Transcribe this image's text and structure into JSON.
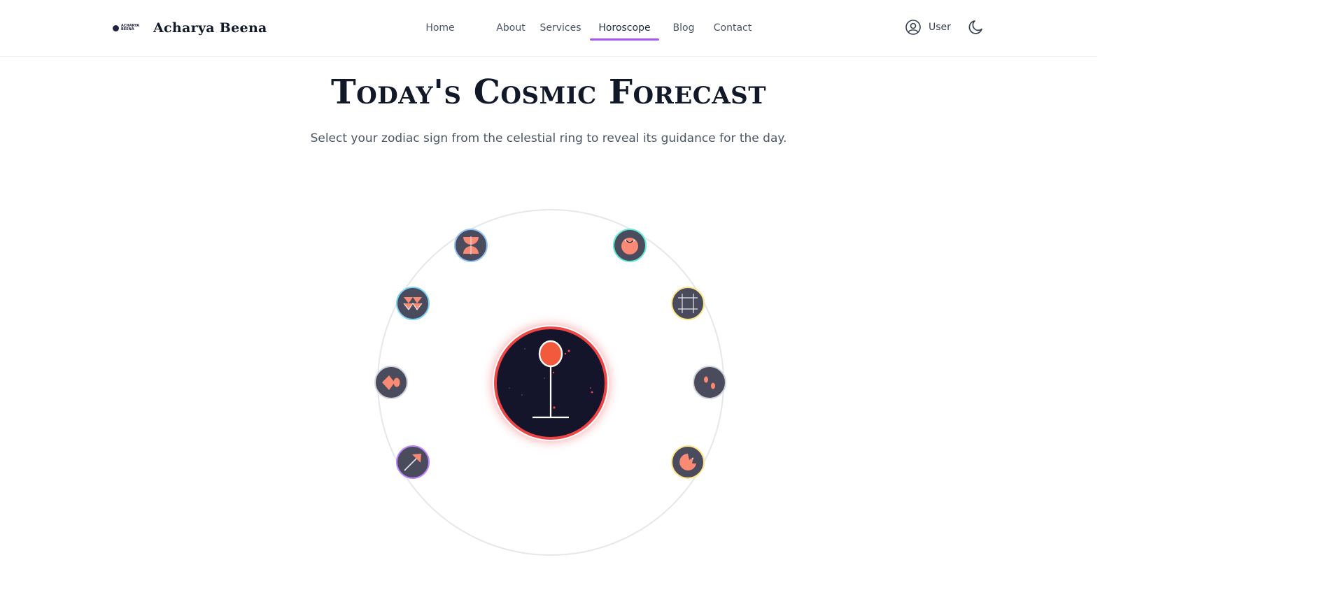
{
  "brand": {
    "logo_text_line1": "ACHARYA",
    "logo_text_line2": "BEENA",
    "name": "Acharya Beena"
  },
  "nav": {
    "items": [
      {
        "label": "Home"
      },
      {
        "label": "About"
      },
      {
        "label": "Services"
      },
      {
        "label": "Horoscope",
        "active": true
      },
      {
        "label": "Blog"
      },
      {
        "label": "Contact"
      }
    ],
    "active_color": "#a855f7"
  },
  "user": {
    "label": "User",
    "icon": "user-circle-icon"
  },
  "theme_toggle": {
    "icon": "moon-icon"
  },
  "hero": {
    "title": "Today's Cosmic Forecast",
    "subtitle": "Select your zodiac sign from the celestial ring to reveal its guidance for the day."
  },
  "zodiac_ring": {
    "selected": "aries",
    "selected_ring_color": "#ef4444",
    "signs": [
      {
        "name": "aries",
        "icon": "aries-icon",
        "border_color": "#ef4444"
      },
      {
        "name": "taurus",
        "icon": "taurus-icon",
        "border_color": "#5eead4"
      },
      {
        "name": "gemini",
        "icon": "gemini-icon",
        "border_color": "#fde68a"
      },
      {
        "name": "cancer",
        "icon": "cancer-icon",
        "border_color": "#d1d5db"
      },
      {
        "name": "leo",
        "icon": "leo-icon",
        "border_color": "#fde68a"
      },
      {
        "name": "sagittarius",
        "icon": "sagittarius-icon",
        "border_color": "#c084fc"
      },
      {
        "name": "capricorn",
        "icon": "capricorn-icon",
        "border_color": "#d1d5db"
      },
      {
        "name": "aquarius",
        "icon": "aquarius-icon",
        "border_color": "#7dd3fc"
      },
      {
        "name": "pisces",
        "icon": "pisces-icon",
        "border_color": "#93c5fd"
      }
    ]
  }
}
